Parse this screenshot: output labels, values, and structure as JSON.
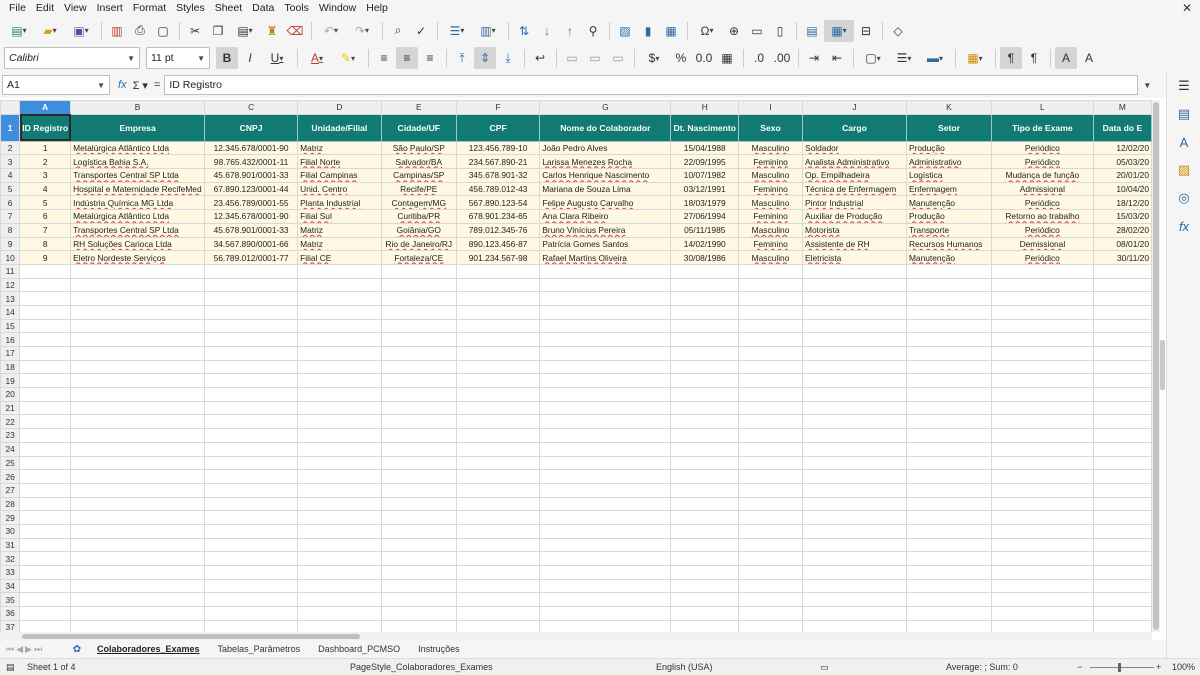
{
  "menu": [
    "File",
    "Edit",
    "View",
    "Insert",
    "Format",
    "Styles",
    "Sheet",
    "Data",
    "Tools",
    "Window",
    "Help"
  ],
  "font": {
    "name": "Calibri",
    "size": "11 pt"
  },
  "name_box": "A1",
  "formula_value": "ID Registro",
  "columns": [
    "A",
    "B",
    "C",
    "D",
    "E",
    "F",
    "G",
    "H",
    "I",
    "J",
    "K",
    "L",
    "M"
  ],
  "headers": [
    "ID Registro",
    "Empresa",
    "CNPJ",
    "Unidade/Filial",
    "Cidade/UF",
    "CPF",
    "Nome do Colaborador",
    "Dt. Nascimento",
    "Sexo",
    "Cargo",
    "Setor",
    "Tipo de Exame",
    "Data do E"
  ],
  "rows": [
    [
      "1",
      "Metalúrgica Atlântico Ltda",
      "12.345.678/0001-90",
      "Matriz",
      "São Paulo/SP",
      "123.456.789-10",
      "João Pedro Alves",
      "15/04/1988",
      "Masculino",
      "Soldador",
      "Produção",
      "Periódico",
      "12/02/20"
    ],
    [
      "2",
      "Logística Bahia S.A.",
      "98.765.432/0001-11",
      "Filial Norte",
      "Salvador/BA",
      "234.567.890-21",
      "Larissa Menezes Rocha",
      "22/09/1995",
      "Feminino",
      "Analista Administrativo",
      "Administrativo",
      "Periódico",
      "05/03/20"
    ],
    [
      "3",
      "Transportes Central SP Ltda",
      "45.678.901/0001-33",
      "Filial Campinas",
      "Campinas/SP",
      "345.678.901-32",
      "Carlos Henrique Nascimento",
      "10/07/1982",
      "Masculino",
      "Op. Empilhadeira",
      "Logística",
      "Mudança de função",
      "20/01/20"
    ],
    [
      "4",
      "Hospital e Maternidade RecifeMed",
      "67.890.123/0001-44",
      "Unid. Centro",
      "Recife/PE",
      "456.789.012-43",
      "Mariana de Souza Lima",
      "03/12/1991",
      "Feminino",
      "Técnica de Enfermagem",
      "Enfermagem",
      "Admissional",
      "10/04/20"
    ],
    [
      "5",
      "Indústria Química MG Ltda",
      "23.456.789/0001-55",
      "Planta Industrial",
      "Contagem/MG",
      "567.890.123-54",
      "Felipe Augusto Carvalho",
      "18/03/1979",
      "Masculino",
      "Pintor Industrial",
      "Manutenção",
      "Periódico",
      "18/12/20"
    ],
    [
      "6",
      "Metalúrgica Atlântico Ltda",
      "12.345.678/0001-90",
      "Filial Sul",
      "Curitiba/PR",
      "678.901.234-65",
      "Ana Clara Ribeiro",
      "27/06/1994",
      "Feminino",
      "Auxiliar de Produção",
      "Produção",
      "Retorno ao trabalho",
      "15/03/20"
    ],
    [
      "7",
      "Transportes Central SP Ltda",
      "45.678.901/0001-33",
      "Matriz",
      "Goiânia/GO",
      "789.012.345-76",
      "Bruno Vinícius Pereira",
      "05/11/1985",
      "Masculino",
      "Motorista",
      "Transporte",
      "Periódico",
      "28/02/20"
    ],
    [
      "8",
      "RH Soluções Carioca Ltda",
      "34.567.890/0001-66",
      "Matriz",
      "Rio de Janeiro/RJ",
      "890.123.456-87",
      "Patrícia Gomes Santos",
      "14/02/1990",
      "Feminino",
      "Assistente de RH",
      "Recursos Humanos",
      "Demissional",
      "08/01/20"
    ],
    [
      "9",
      "Eletro Nordeste Serviços",
      "56.789.012/0001-77",
      "Filial CE",
      "Fortaleza/CE",
      "901.234.567-98",
      "Rafael Martins Oliveira",
      "30/08/1986",
      "Masculino",
      "Eletricista",
      "Manutenção",
      "Periódico",
      "30/11/20"
    ]
  ],
  "empty_row_numbers": [
    "11",
    "12",
    "13",
    "14",
    "15",
    "16",
    "17",
    "18",
    "19",
    "20",
    "21",
    "22",
    "23",
    "24",
    "25",
    "26",
    "27",
    "28",
    "29",
    "30",
    "31",
    "32",
    "33",
    "34",
    "35",
    "36",
    "37"
  ],
  "tabs": [
    "Colaboradores_Exames",
    "Tabelas_Parâmetros",
    "Dashboard_PCMSO",
    "Instruções"
  ],
  "active_tab": "Colaboradores_Exames",
  "status": {
    "sheet": "Sheet 1 of 4",
    "page_style": "PageStyle_Colaboradores_Exames",
    "language": "English (USA)",
    "summary": "Average: ; Sum: 0",
    "zoom": "100%"
  },
  "colors": {
    "header_fill": "#117a73",
    "data_fill": "#fff9e3",
    "selection": "#3e8ede"
  }
}
